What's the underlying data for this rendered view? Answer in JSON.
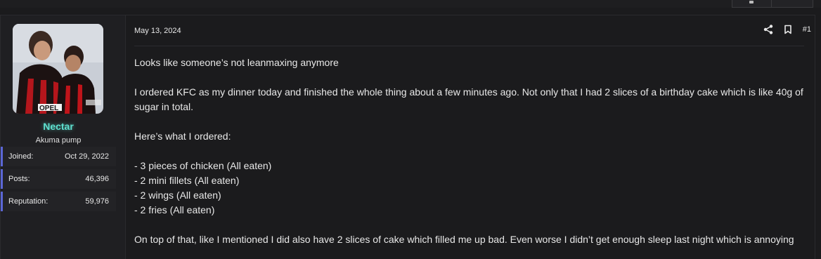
{
  "user": {
    "name": "Nectar",
    "title": "Akuma pump",
    "stats": [
      {
        "label": "Joined:",
        "value": "Oct 29, 2022"
      },
      {
        "label": "Posts:",
        "value": "46,396"
      },
      {
        "label": "Reputation:",
        "value": "59,976"
      }
    ]
  },
  "post": {
    "date": "May 13, 2024",
    "number": "#1",
    "lines": [
      "Looks like someone’s not leanmaxing anymore",
      "",
      "I ordered KFC as my dinner today and finished the whole thing about a few minutes ago. Not only that I had 2 slices of a birthday cake which is like 40g of sugar in total.",
      "",
      "Here’s what I ordered:",
      "",
      "- 3 pieces of chicken (All eaten)",
      "- 2 mini fillets (All eaten)",
      "- 2 wings (All eaten)",
      "- 2 fries (All eaten)",
      "",
      "On top of that, like I mentioned I did also have 2 slices of cake which filled me up bad. Even worse I didn’t get enough sleep last night which is annoying"
    ]
  },
  "icons": {
    "share": "share-icon",
    "bookmark": "bookmark-icon"
  },
  "colors": {
    "username": "#5ee0cf",
    "stat_accent": "#5b67d6"
  }
}
